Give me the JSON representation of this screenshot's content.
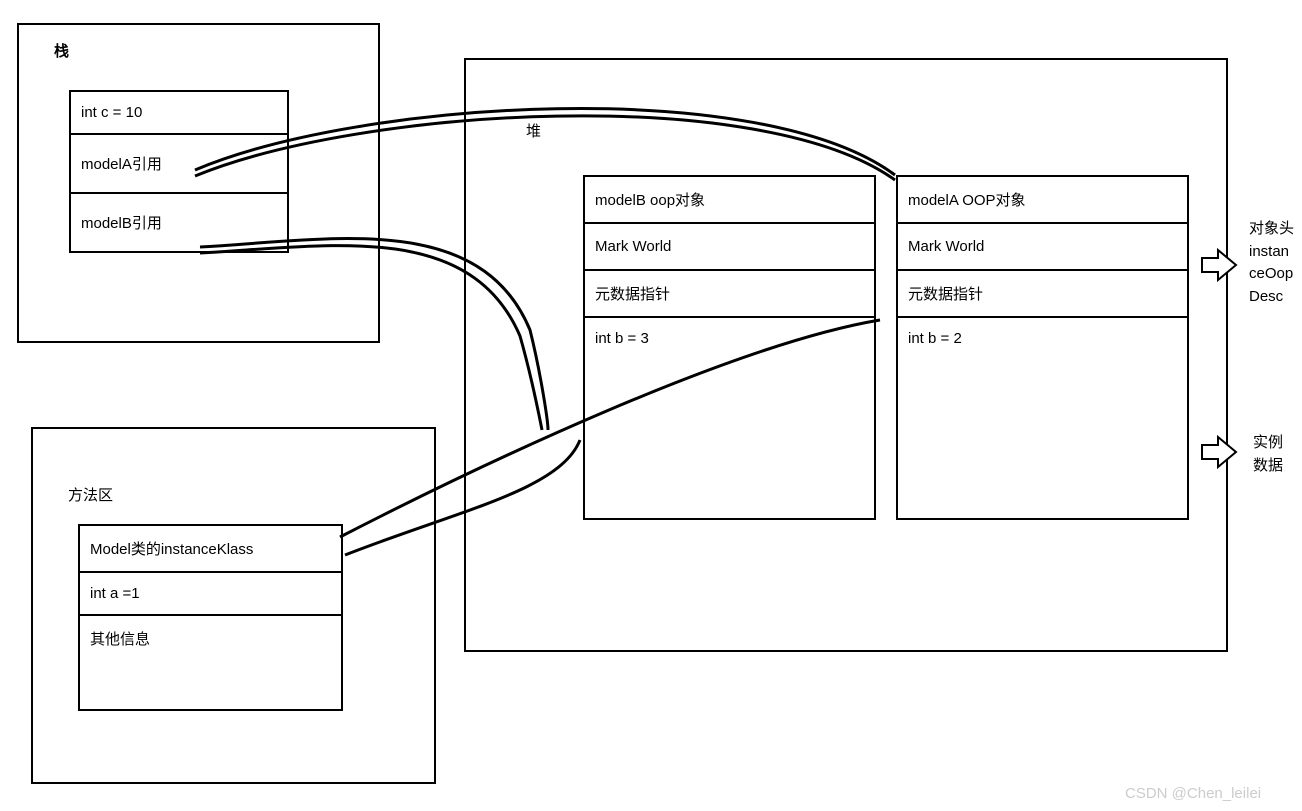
{
  "stack": {
    "title": "栈",
    "cells": [
      "int c = 10",
      "modelA引用",
      "modelB引用"
    ]
  },
  "heap": {
    "title": "堆",
    "objectB": {
      "title": "modelB oop对象",
      "cells": [
        "Mark World",
        "元数据指针",
        "int b = 3"
      ]
    },
    "objectA": {
      "title": "modelA OOP对象",
      "cells": [
        "Mark World",
        "元数据指针",
        "int b = 2"
      ]
    }
  },
  "methodArea": {
    "title": "方法区",
    "cells": [
      "Model类的instanceKlass",
      "int a =1",
      "其他信息"
    ]
  },
  "annotations": {
    "header": "对象头\ninstanceOopDesc",
    "instanceData": "实例\n数据"
  },
  "watermark": "CSDN @Chen_leilei"
}
